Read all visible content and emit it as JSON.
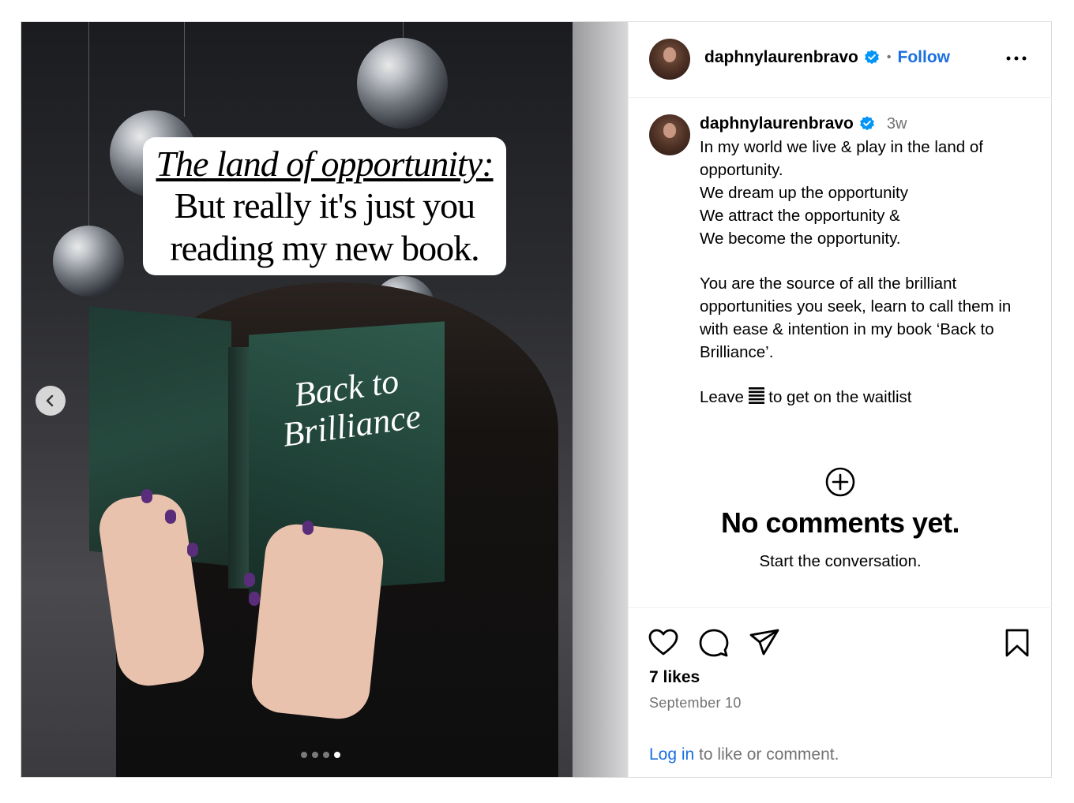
{
  "media": {
    "caption_line1": "The land of opportunity:",
    "caption_line2": "But really it's just you",
    "caption_line3": "reading my new book.",
    "book_title": "Back to Brilliance",
    "carousel_dots": 4,
    "active_dot": 4
  },
  "header": {
    "username": "daphnylaurenbravo",
    "separator": "•",
    "follow_label": "Follow"
  },
  "post": {
    "username": "daphnylaurenbravo",
    "time_ago": "3w",
    "caption": [
      "In my world we live & play in the land of opportunity.",
      "We dream up the opportunity",
      "We attract the opportunity &",
      "We become the opportunity."
    ],
    "caption2": "You are the source of all the brilliant opportunities you seek, learn to call them in with ease & intention in my book ‘Back to Brilliance’.",
    "caption3_prefix": "Leave ",
    "caption3_suffix": " to get on the waitlist"
  },
  "comments": {
    "title": "No comments yet.",
    "subtitle": "Start the conversation."
  },
  "footer": {
    "likes": "7 likes",
    "date": "September 10",
    "login_link": "Log in",
    "login_rest": " to like or comment."
  },
  "icons": {
    "verified": "verified-badge-icon",
    "more": "more-options-icon",
    "like": "heart-icon",
    "comment": "comment-icon",
    "share": "share-icon",
    "save": "bookmark-icon",
    "add": "add-circle-icon",
    "prev": "chevron-left-icon"
  },
  "colors": {
    "link_blue": "#1a6fe0",
    "muted_gray": "#737373",
    "verified_blue": "#0095f6"
  }
}
